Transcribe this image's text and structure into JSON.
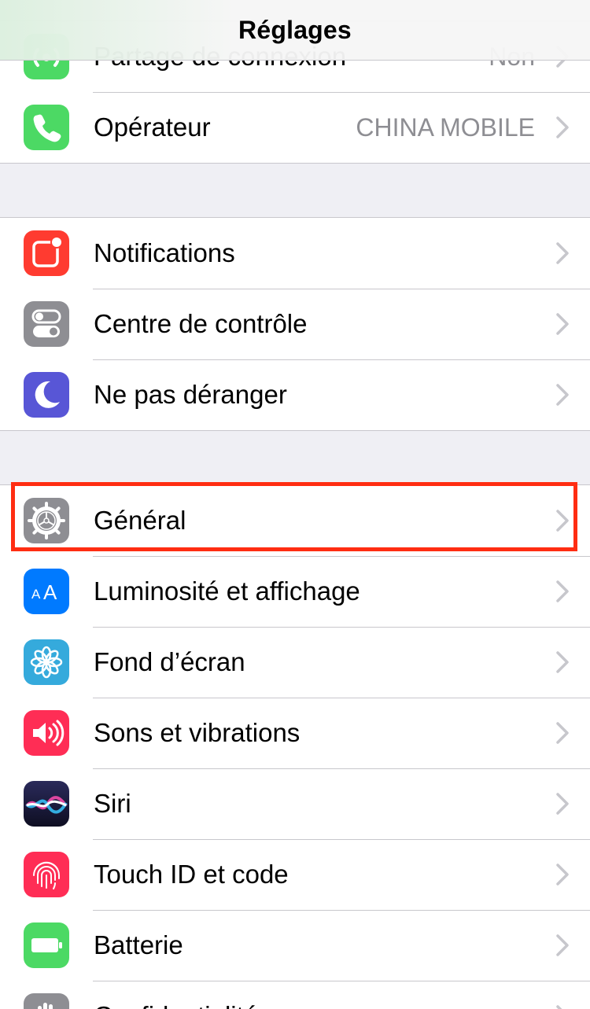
{
  "nav": {
    "title": "Réglages"
  },
  "groups": [
    {
      "rows": [
        {
          "id": "partage",
          "label": "Partage de connexion",
          "value": "Non",
          "icon": "hotspot-icon",
          "color": "#4cd964"
        },
        {
          "id": "operateur",
          "label": "Opérateur",
          "value": "CHINA MOBILE",
          "icon": "phone-icon",
          "color": "#4cd964"
        }
      ]
    },
    {
      "rows": [
        {
          "id": "notifications",
          "label": "Notifications",
          "icon": "notifications-icon",
          "color": "#ff3b30"
        },
        {
          "id": "centre-controle",
          "label": "Centre de contrôle",
          "icon": "control-center-icon",
          "color": "#8e8e93"
        },
        {
          "id": "ne-pas-deranger",
          "label": "Ne pas déranger",
          "icon": "moon-icon",
          "color": "#5856d6"
        }
      ]
    },
    {
      "rows": [
        {
          "id": "general",
          "label": "Général",
          "icon": "gear-icon",
          "color": "#8e8e93",
          "highlighted": true
        },
        {
          "id": "luminosite",
          "label": "Luminosité et affichage",
          "icon": "text-size-icon",
          "color": "#007aff"
        },
        {
          "id": "fond-ecran",
          "label": "Fond d’écran",
          "icon": "flower-icon",
          "color": "#35aadc"
        },
        {
          "id": "sons",
          "label": "Sons et vibrations",
          "icon": "speaker-icon",
          "color": "#ff2d55"
        },
        {
          "id": "siri",
          "label": "Siri",
          "icon": "siri-icon",
          "color": "#1b1b3a"
        },
        {
          "id": "touch-id",
          "label": "Touch ID et code",
          "icon": "fingerprint-icon",
          "color": "#ff2d55"
        },
        {
          "id": "batterie",
          "label": "Batterie",
          "icon": "battery-icon",
          "color": "#4cd964"
        },
        {
          "id": "confidentialite",
          "label": "Confidentialité",
          "icon": "hand-icon",
          "color": "#8e8e93"
        }
      ]
    }
  ],
  "highlight": {
    "color": "#ff2d12"
  }
}
